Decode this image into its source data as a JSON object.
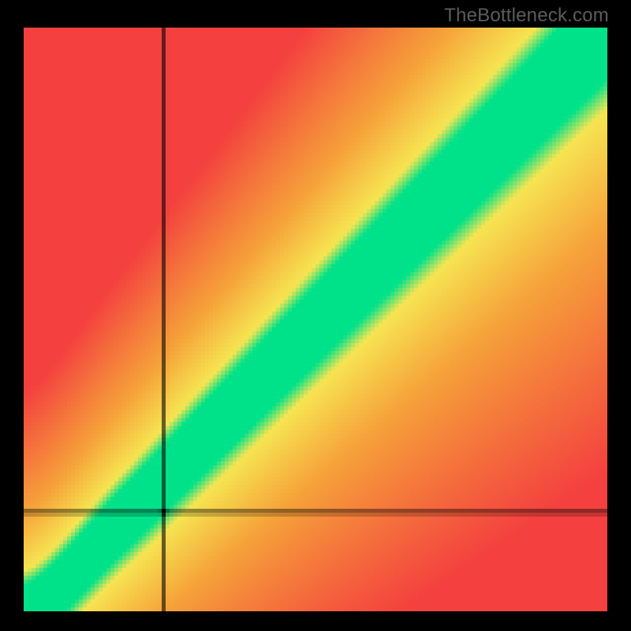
{
  "watermark": "TheBottleneck.com",
  "chart_data": {
    "type": "heatmap",
    "title": "",
    "xlabel": "",
    "ylabel": "",
    "xlim": [
      0,
      100
    ],
    "ylim": [
      0,
      100
    ],
    "crosshair": {
      "x": 24,
      "y": 17
    },
    "marker": {
      "x": 24,
      "y": 17,
      "radius_px": 4,
      "color": "#000000"
    },
    "optimal_band": {
      "description": "Green diagonal band where CPU and GPU scores are balanced (graphic-intensive slope ~1.0). Yellow transition band around it; red far from balance.",
      "center_slope": 1.02,
      "center_intercept": -1.5,
      "green_half_width_score_units": 6,
      "yellow_half_width_score_units": 20,
      "low_end_curve": "Band curves toward origin below ~18 on both axes (7th-gen-task / low-end region)."
    },
    "color_stops": {
      "optimal": "#00e28a",
      "near": "#f7e552",
      "mid": "#f6a33a",
      "far": "#f4413f"
    },
    "grid": false,
    "legend": null
  }
}
